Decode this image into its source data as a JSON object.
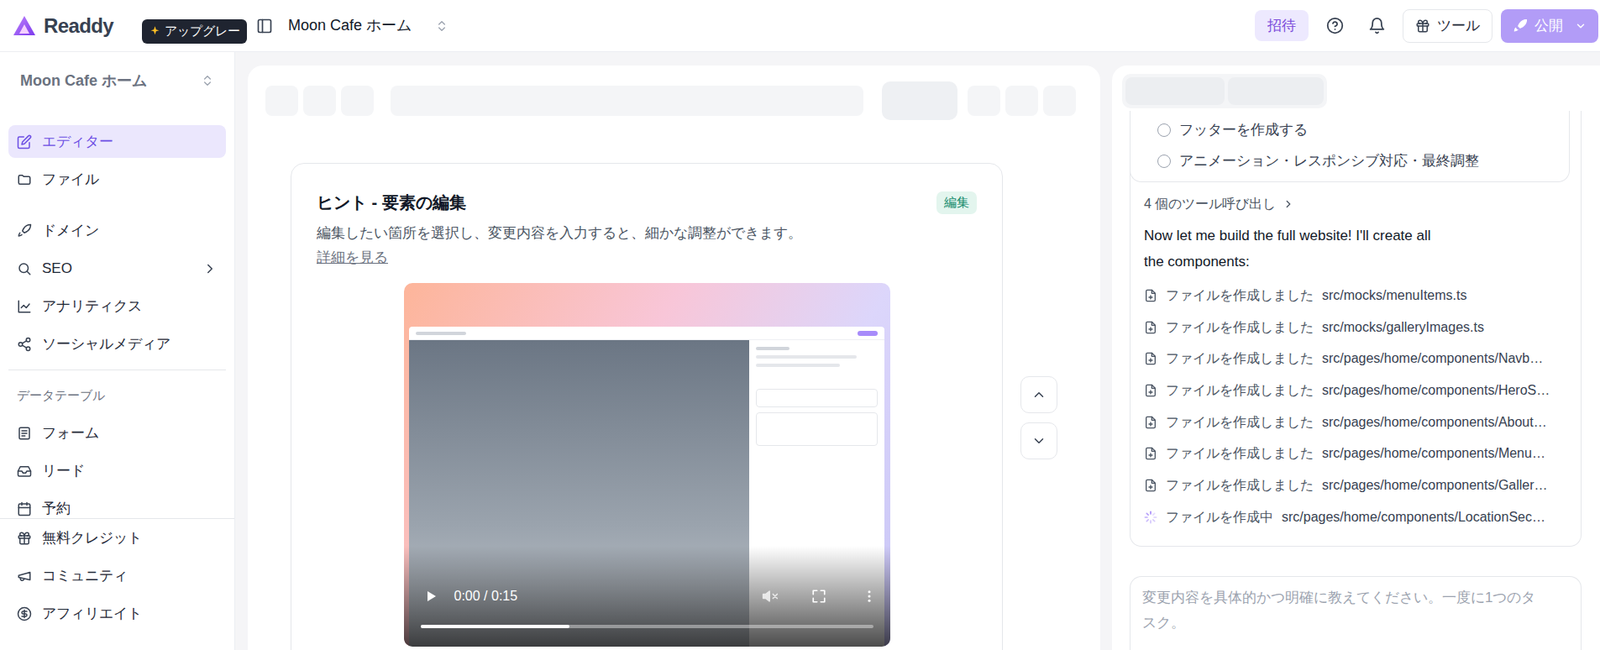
{
  "app": {
    "logo": "Readdy",
    "upgrade_badge": "アップグレー"
  },
  "topbar": {
    "project": "Moon Cafe ホーム",
    "invite": "招待",
    "tools": "ツール",
    "publish": "公開"
  },
  "sidebar": {
    "project": "Moon Cafe ホーム",
    "items": [
      {
        "label": "エディター",
        "selected": true,
        "has_arrow": false
      },
      {
        "label": "ファイル",
        "selected": false,
        "has_arrow": false
      },
      {
        "label": "ドメイン",
        "selected": false,
        "has_arrow": false
      },
      {
        "label": "SEO",
        "selected": false,
        "has_arrow": true
      },
      {
        "label": "アナリティクス",
        "selected": false,
        "has_arrow": false
      },
      {
        "label": "ソーシャルメディア",
        "selected": false,
        "has_arrow": false
      }
    ],
    "section_title": "データテーブル",
    "table_items": [
      {
        "label": "フォーム",
        "selected": false
      },
      {
        "label": "リード",
        "selected": false
      },
      {
        "label": "予約",
        "selected": false
      }
    ],
    "footer_items": [
      {
        "label": "無料クレジット"
      },
      {
        "label": "コミュニティ"
      },
      {
        "label": "アフィリエイト"
      }
    ]
  },
  "hint": {
    "title": "ヒント - 要素の編集",
    "badge": "編集",
    "description": "編集したい箇所を選択し、変更内容を入力すると、細かな調整ができます。",
    "link": "詳細を見る"
  },
  "video": {
    "time": "0:00 / 0:15",
    "level": 0.33,
    "muted": true,
    "playing": false
  },
  "tasks": [
    {
      "label": "フッターを作成する",
      "done": false
    },
    {
      "label": "アニメーション・レスポンシブ対応・最終調整",
      "done": false
    }
  ],
  "tool_calls": "4 個のツール呼び出し",
  "message": "Now let me build the full website! I'll create all the components:",
  "files": [
    {
      "status": "ファイルを作成しました",
      "path": "src/mocks/menuItems.ts",
      "done": true
    },
    {
      "status": "ファイルを作成しました",
      "path": "src/mocks/galleryImages.ts",
      "done": true
    },
    {
      "status": "ファイルを作成しました",
      "path": "src/pages/home/components/Navb…",
      "done": true
    },
    {
      "status": "ファイルを作成しました",
      "path": "src/pages/home/components/HeroS…",
      "done": true
    },
    {
      "status": "ファイルを作成しました",
      "path": "src/pages/home/components/About…",
      "done": true
    },
    {
      "status": "ファイルを作成しました",
      "path": "src/pages/home/components/Menu…",
      "done": true
    },
    {
      "status": "ファイルを作成しました",
      "path": "src/pages/home/components/Galler…",
      "done": true
    },
    {
      "status": "ファイルを作成中",
      "path": "src/pages/home/components/LocationSec…",
      "done": false
    }
  ],
  "composer": {
    "placeholder": "変更内容を具体的かつ明確に教えてください。一度に1つのタスク。"
  }
}
